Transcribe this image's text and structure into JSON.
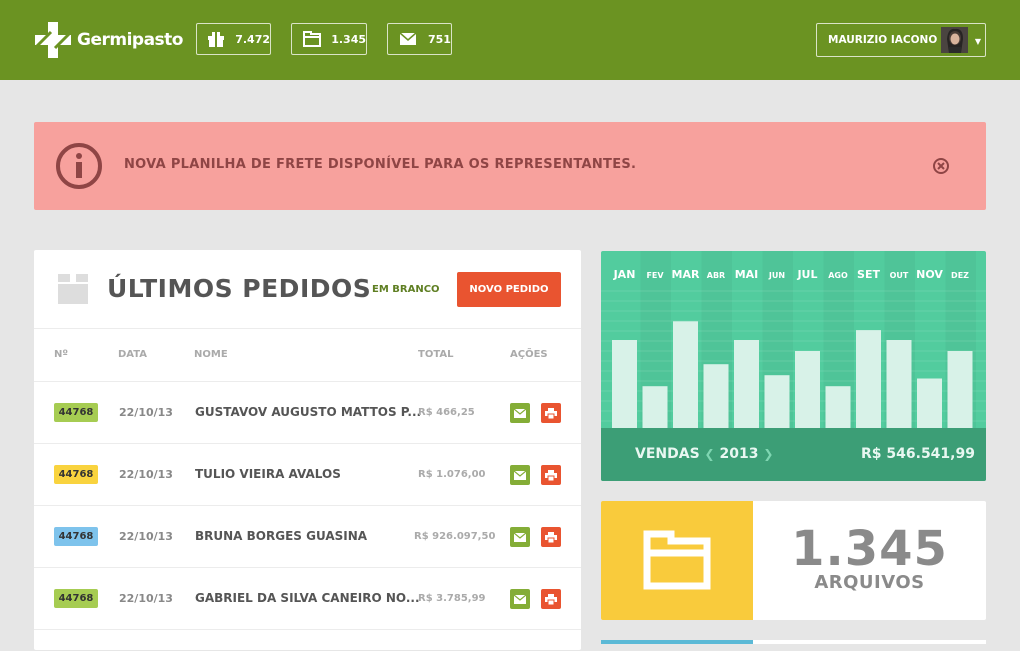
{
  "topbar": {
    "brand": "Germipasto",
    "stats": [
      {
        "icon": "gift-icon",
        "value": "7.472"
      },
      {
        "icon": "folder-icon",
        "value": "1.345"
      },
      {
        "icon": "mail-icon",
        "value": "751"
      }
    ],
    "user": {
      "name": "MAURIZIO IACONO",
      "avatar": "avatar-icon"
    }
  },
  "alert": {
    "message": "NOVA PLANILHA DE FRETE DISPONÍVEL PARA OS REPRESENTANTES.",
    "icon": "info-icon",
    "close_icon": "close-circle-icon"
  },
  "orders": {
    "title": "ÚLTIMOS PEDIDOS",
    "blank_link": "EM BRANCO",
    "new_button": "NOVO PEDIDO",
    "columns": [
      "Nº",
      "DATA",
      "NOME",
      "TOTAL",
      "AÇÕES"
    ],
    "rows": [
      {
        "number": "44768",
        "badge_color": "#a6cc52",
        "date": "22/10/13",
        "name": "GUSTAVOV AUGUSTO MATTOS P...",
        "total": "R$ 466,25"
      },
      {
        "number": "44768",
        "badge_color": "#f9d33e",
        "date": "22/10/13",
        "name": "TULIO VIEIRA AVALOS",
        "total": "R$ 1.076,00"
      },
      {
        "number": "44768",
        "badge_color": "#7ec3ec",
        "date": "22/10/13",
        "name": "BRUNA BORGES GUASINA",
        "total": "R$ 926.097,50"
      },
      {
        "number": "44768",
        "badge_color": "#a6cc52",
        "date": "22/10/13",
        "name": "GABRIEL DA SILVA CANEIRO NO...",
        "total": "R$ 3.785,99"
      }
    ]
  },
  "chart_data": {
    "type": "bar",
    "categories": [
      "JAN",
      "FEV",
      "MAR",
      "ABR",
      "MAI",
      "JUN",
      "JUL",
      "AGO",
      "SET",
      "OUT",
      "NOV",
      "DEZ"
    ],
    "values": [
      80,
      38,
      97,
      58,
      80,
      48,
      70,
      38,
      89,
      80,
      45,
      70
    ],
    "ylim": [
      0,
      100
    ],
    "grid": true,
    "colors": {
      "bar": "#d8f2e8",
      "background": "#52cc9e",
      "footer": "#3c9e76"
    },
    "footer_label": "VENDAS",
    "year": "2013",
    "total": "R$ 546.541,99"
  },
  "files": {
    "value": "1.345",
    "label": "ARQUIVOS",
    "icon": "folder-icon",
    "accent": "#f9cb3c"
  }
}
